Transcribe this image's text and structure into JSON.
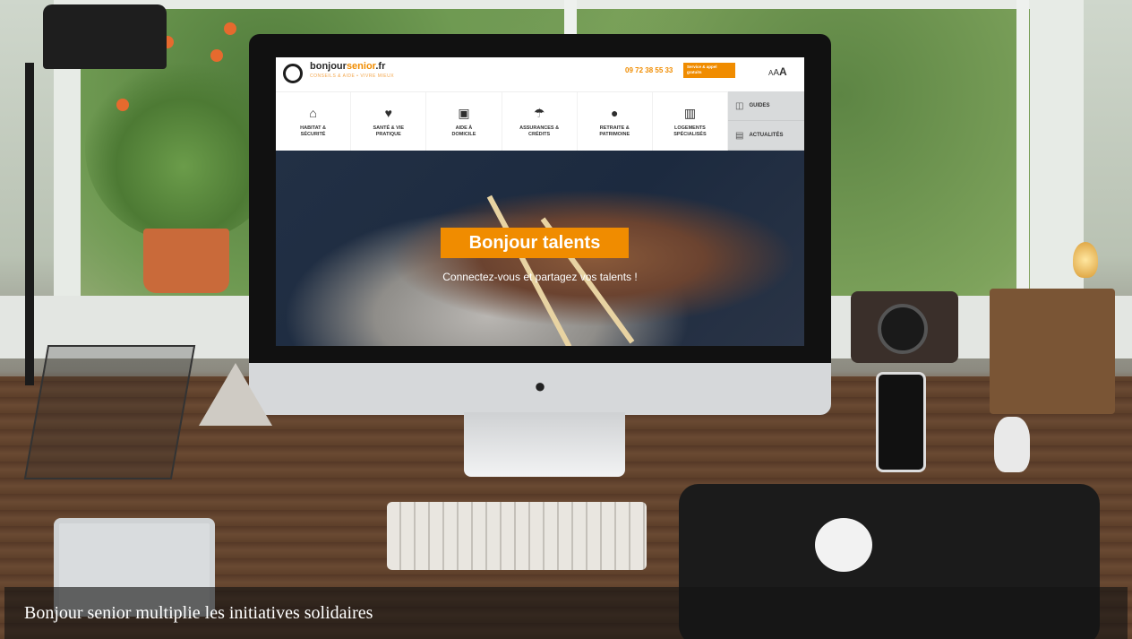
{
  "website": {
    "logo": {
      "brand_prefix": "bonjour",
      "brand_accent": "senior",
      "brand_suffix": ".fr",
      "tagline": "CONSEILS & AIDE • VIVRE MIEUX"
    },
    "phone": "09 72 38 55 33",
    "phone_badge": "Service & appel gratuits",
    "font_size_control": {
      "small": "A",
      "medium": "A",
      "large": "A"
    },
    "nav": [
      {
        "label": "HABITAT &\nSÉCURITÉ",
        "icon": "home-icon"
      },
      {
        "label": "SANTÉ & VIE\nPRATIQUE",
        "icon": "heart-pulse-icon"
      },
      {
        "label": "AIDE À\nDOMICILE",
        "icon": "armchair-icon"
      },
      {
        "label": "ASSURANCES &\nCRÉDITS",
        "icon": "umbrella-icon"
      },
      {
        "label": "RETRAITE &\nPATRIMOINE",
        "icon": "piggy-bank-icon"
      },
      {
        "label": "LOGEMENTS\nSPÉCIALISÉS",
        "icon": "building-icon"
      }
    ],
    "side_menu": [
      {
        "label": "GUIDES",
        "icon": "book-icon"
      },
      {
        "label": "ACTUALITÉS",
        "icon": "newspaper-icon"
      }
    ],
    "hero": {
      "title": "Bonjour talents",
      "subtitle": "Connectez-vous et partagez vos talents !"
    }
  },
  "caption": "Bonjour senior multiplie les initiatives solidaires",
  "colors": {
    "brand_orange": "#f08c00",
    "caption_bg": "rgba(20,20,20,0.62)"
  }
}
